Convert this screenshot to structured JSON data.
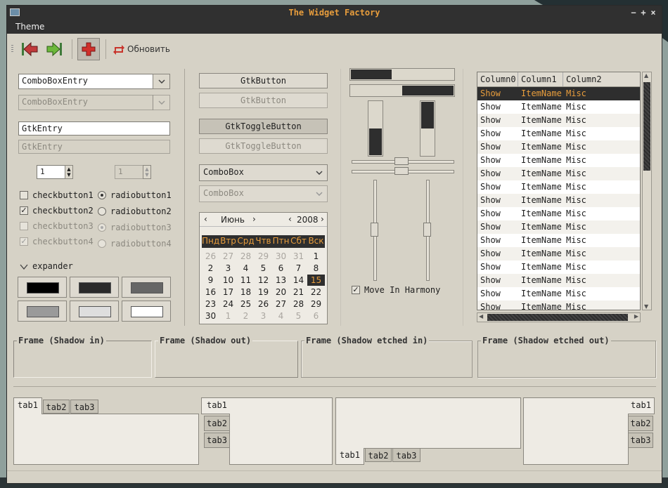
{
  "window": {
    "title": "The Widget Factory",
    "ctl_min": "−",
    "ctl_max": "+",
    "ctl_close": "×"
  },
  "menu": {
    "theme": "Theme"
  },
  "toolbar": {
    "refresh_label": "Обновить"
  },
  "combos": {
    "entry1": "ComboBoxEntry",
    "entry2": "ComboBoxEntry",
    "combo1": "ComboBox",
    "combo2": "ComboBox"
  },
  "entries": {
    "entry1": "GtkEntry",
    "entry2": "GtkEntry"
  },
  "spins": {
    "spin1": "1",
    "spin2": "1"
  },
  "checks": [
    {
      "label": "checkbutton1",
      "checked": false
    },
    {
      "label": "checkbutton2",
      "checked": true
    },
    {
      "label": "checkbutton3",
      "checked": false
    },
    {
      "label": "checkbutton4",
      "checked": true
    }
  ],
  "radios": [
    {
      "label": "radiobutton1"
    },
    {
      "label": "radiobutton2"
    },
    {
      "label": "radiobutton3"
    },
    {
      "label": "radiobutton4"
    }
  ],
  "expander": {
    "label": "expander"
  },
  "buttons": {
    "b1": "GtkButton",
    "b2": "GtkButton",
    "t1": "GtkToggleButton",
    "t2": "GtkToggleButton"
  },
  "calendar": {
    "month": "Июнь",
    "year": "2008",
    "weekdays": [
      "Пнд",
      "Втр",
      "Срд",
      "Чтв",
      "Птн",
      "Сбт",
      "Вск"
    ],
    "weeks": [
      [
        "26",
        "27",
        "28",
        "29",
        "30",
        "31",
        "1"
      ],
      [
        "2",
        "3",
        "4",
        "5",
        "6",
        "7",
        "8"
      ],
      [
        "9",
        "10",
        "11",
        "12",
        "13",
        "14",
        "15"
      ],
      [
        "16",
        "17",
        "18",
        "19",
        "20",
        "21",
        "22"
      ],
      [
        "23",
        "24",
        "25",
        "26",
        "27",
        "28",
        "29"
      ],
      [
        "30",
        "1",
        "2",
        "3",
        "4",
        "5",
        "6"
      ]
    ],
    "selected": "15",
    "accent": "#e89d3c"
  },
  "progress": {
    "p1": 0.4,
    "p2": 0.5
  },
  "harmony": {
    "label": "Move In Harmony",
    "checked": true
  },
  "tree": {
    "columns": [
      "Column0",
      "Column1",
      "Column2"
    ],
    "rows": [
      [
        "Show",
        "ItemName",
        "Misc"
      ],
      [
        "Show",
        "ItemName",
        "Misc"
      ],
      [
        "Show",
        "ItemName",
        "Misc"
      ],
      [
        "Show",
        "ItemName",
        "Misc"
      ],
      [
        "Show",
        "ItemName",
        "Misc"
      ],
      [
        "Show",
        "ItemName",
        "Misc"
      ],
      [
        "Show",
        "ItemName",
        "Misc"
      ],
      [
        "Show",
        "ItemName",
        "Misc"
      ],
      [
        "Show",
        "ItemName",
        "Misc"
      ],
      [
        "Show",
        "ItemName",
        "Misc"
      ],
      [
        "Show",
        "ItemName",
        "Misc"
      ],
      [
        "Show",
        "ItemName",
        "Misc"
      ],
      [
        "Show",
        "ItemName",
        "Misc"
      ],
      [
        "Show",
        "ItemName",
        "Misc"
      ],
      [
        "Show",
        "ItemName",
        "Misc"
      ],
      [
        "Show",
        "ItemName",
        "Misc"
      ],
      [
        "Show",
        "ItemName",
        "Misc"
      ]
    ]
  },
  "frames": [
    "Frame (Shadow in)",
    "Frame (Shadow out)",
    "Frame (Shadow etched in)",
    "Frame (Shadow etched out)"
  ],
  "tabs": [
    "tab1",
    "tab2",
    "tab3"
  ],
  "colors": {
    "title_bg": "#303030",
    "accent": "#e89d3c",
    "window_bg": "#d6d2c6",
    "selected_row": "#2e2e2e"
  }
}
